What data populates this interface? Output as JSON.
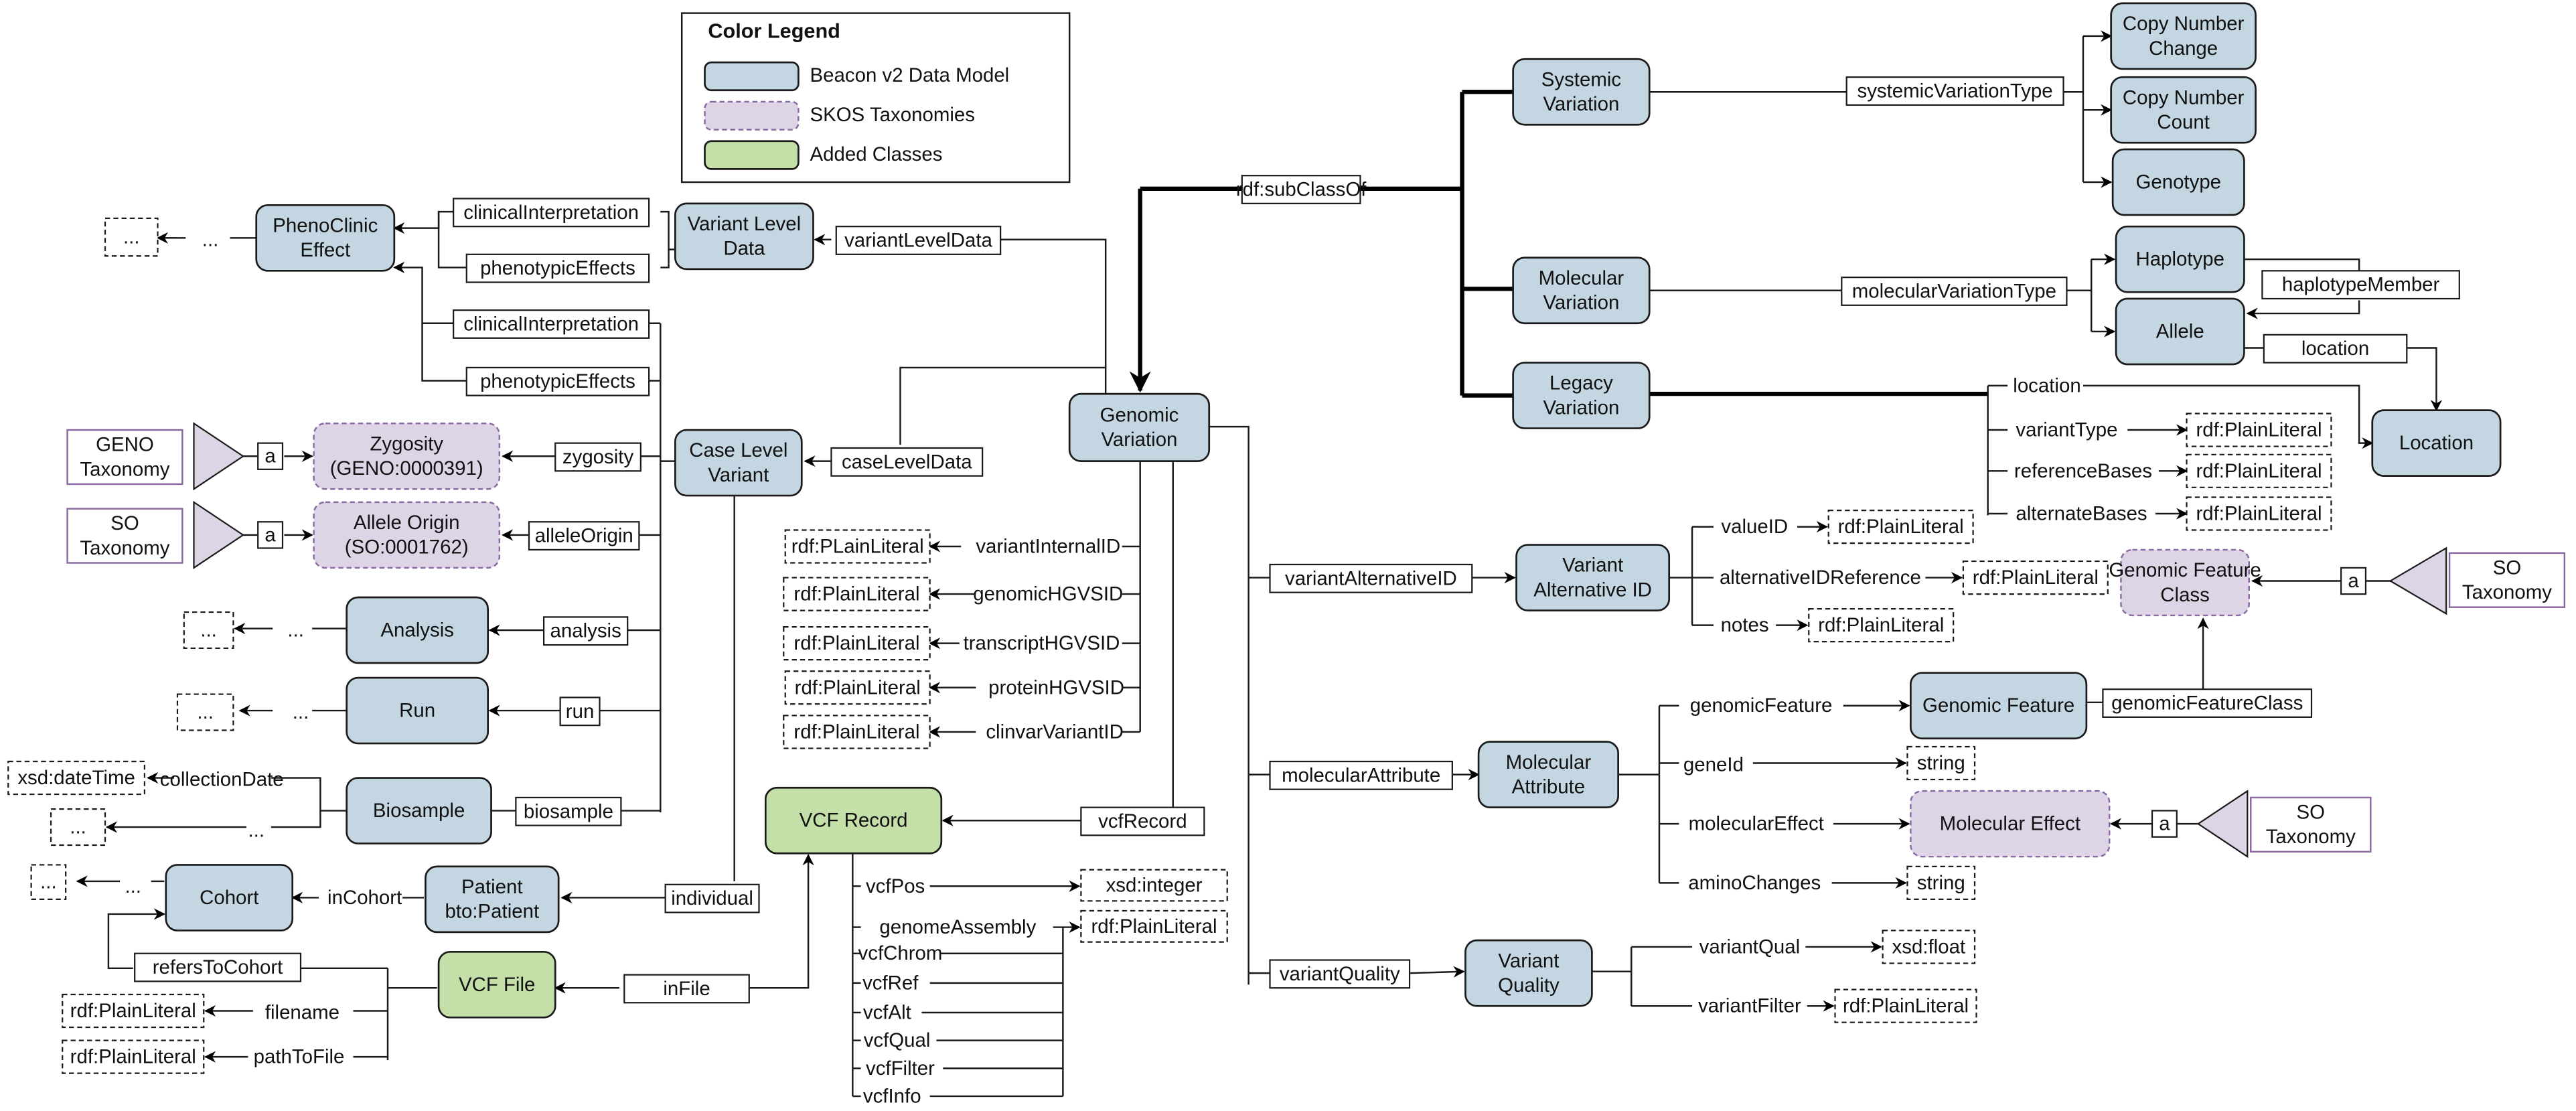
{
  "legend": {
    "title": "Color Legend",
    "items": [
      {
        "label": "Beacon v2 Data Model",
        "kind": "cls",
        "color": "#c3d6e1"
      },
      {
        "label": "SKOS Taxonomies",
        "kind": "skos",
        "color": "#ddd4e6"
      },
      {
        "label": "Added Classes",
        "kind": "added",
        "color": "#c5dfa9"
      }
    ]
  },
  "colors": {
    "beacon_class": "#c3d6e1",
    "skos_taxonomy": "#ddd4e6",
    "added_class": "#c5dfa9",
    "skos_border": "#8b6aa3",
    "line": "#1a1a1a"
  },
  "nodes": {
    "phenoclinic_effect": [
      "PhenoClinic",
      "Effect"
    ],
    "variant_level_data": [
      "Variant Level",
      "Data"
    ],
    "case_level_variant": [
      "Case Level",
      "Variant"
    ],
    "genomic_variation": [
      "Genomic",
      "Variation"
    ],
    "zygosity": [
      "Zygosity",
      "(GENO:0000391)"
    ],
    "allele_origin": [
      "Allele Origin",
      "(SO:0001762)"
    ],
    "geno_taxonomy": [
      "GENO",
      "Taxonomy"
    ],
    "so_taxonomy_1": [
      "SO",
      "Taxonomy"
    ],
    "so_taxonomy_2": [
      "SO",
      "Taxonomy"
    ],
    "so_taxonomy_3": [
      "SO",
      "Taxonomy"
    ],
    "analysis": [
      "Analysis"
    ],
    "run": [
      "Run"
    ],
    "biosample": [
      "Biosample"
    ],
    "cohort": [
      "Cohort"
    ],
    "patient": [
      "Patient",
      "bto:Patient"
    ],
    "vcf_file": [
      "VCF File"
    ],
    "vcf_record": [
      "VCF Record"
    ],
    "systemic_variation": [
      "Systemic",
      "Variation"
    ],
    "molecular_variation": [
      "Molecular",
      "Variation"
    ],
    "legacy_variation": [
      "Legacy",
      "Variation"
    ],
    "copy_number_change": [
      "Copy Number",
      "Change"
    ],
    "copy_number_count": [
      "Copy Number",
      "Count"
    ],
    "genotype": [
      "Genotype"
    ],
    "haplotype": [
      "Haplotype"
    ],
    "allele": [
      "Allele"
    ],
    "location": [
      "Location"
    ],
    "variant_alternative_id": [
      "Variant",
      "Alternative ID"
    ],
    "genomic_feature_class": [
      "Genomic Feature",
      "Class"
    ],
    "genomic_feature": [
      "Genomic Feature"
    ],
    "molecular_attribute": [
      "Molecular",
      "Attribute"
    ],
    "molecular_effect": [
      "Molecular Effect"
    ],
    "variant_quality": [
      "Variant",
      "Quality"
    ]
  },
  "literals": {
    "ellipsis": "...",
    "xsd_datetime": "xsd:dateTime",
    "plain_literal_variant": "rdf:PLainLiteral",
    "plain_literal": "rdf:PlainLiteral",
    "xsd_integer": "xsd:integer",
    "xsd_float": "xsd:float",
    "string": "string"
  },
  "properties": {
    "clinical_interpretation": "clinicalInterpretation",
    "phenotypic_effects": "phenotypicEffects",
    "variant_level_data": "variantLevelData",
    "case_level_data": "caseLevelData",
    "zygosity": "zygosity",
    "allele_origin": "alleleOrigin",
    "analysis": "analysis",
    "run": "run",
    "biosample": "biosample",
    "collection_date": "collectionDate",
    "in_cohort": "inCohort",
    "individual": "individual",
    "refers_to_cohort": "refersToCohort",
    "in_file": "inFile",
    "filename": "filename",
    "path_to_file": "pathToFile",
    "vcf_record": "vcfRecord",
    "variant_internal_id": "variantInternalID",
    "genomic_hgvs_id": "genomicHGVSID",
    "transcript_hgvs_id": "transcriptHGVSID",
    "protein_hgvs_id": "proteinHGVSID",
    "clinvar_variant_id": "clinvarVariantID",
    "vcf_pos": "vcfPos",
    "genome_assembly": "genomeAssembly",
    "vcf_chrom": "vcfChrom",
    "vcf_ref": "vcfRef",
    "vcf_alt": "vcfAlt",
    "vcf_qual": "vcfQual",
    "vcf_filter": "vcfFilter",
    "vcf_info": "vcfInfo",
    "subclass_of": "rdf:subClassOf",
    "systemic_variation_type": "systemicVariationType",
    "molecular_variation_type": "molecularVariationType",
    "haplotype_member": "haplotypeMember",
    "location": "location",
    "variant_type": "variantType",
    "reference_bases": "referenceBases",
    "alternate_bases": "alternateBases",
    "variant_alternative_id": "variantAlternativeID",
    "value_id": "valueID",
    "alternative_id_reference": "alternativeIDReference",
    "notes": "notes",
    "molecular_attribute": "molecularAttribute",
    "genomic_feature": "genomicFeature",
    "genomic_feature_class": "genomicFeatureClass",
    "gene_id": "geneId",
    "molecular_effect": "molecularEffect",
    "amino_changes": "aminoChanges",
    "variant_quality": "variantQuality",
    "variant_qual": "variantQual",
    "variant_filter": "variantFilter",
    "instance_of": "a"
  }
}
